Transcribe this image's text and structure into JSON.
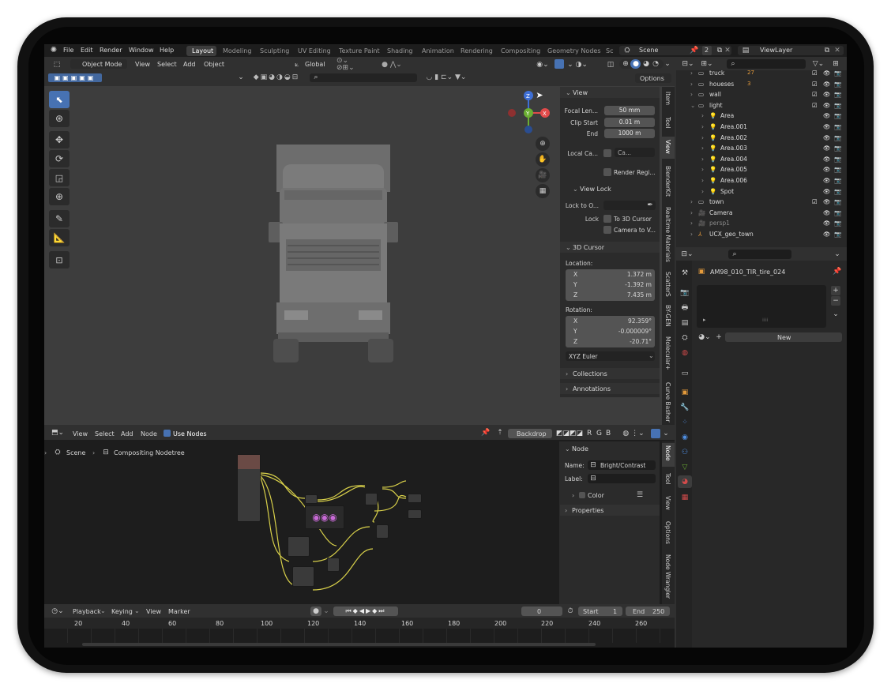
{
  "menubar": {
    "file": "File",
    "edit": "Edit",
    "render": "Render",
    "window": "Window",
    "help": "Help"
  },
  "workspaces": [
    "Layout",
    "Modeling",
    "Sculpting",
    "UV Editing",
    "Texture Paint",
    "Shading",
    "Animation",
    "Rendering",
    "Compositing",
    "Geometry Nodes",
    "Sc"
  ],
  "scene": {
    "label": "Scene",
    "users": "2"
  },
  "viewlayer": "ViewLayer",
  "viewport_header": {
    "mode": "Object Mode",
    "view": "View",
    "select": "Select",
    "add": "Add",
    "object": "Object",
    "transform": "Global",
    "options": "Options"
  },
  "n_panel_view": {
    "title": "View",
    "focal_label": "Focal Len...",
    "focal": "50 mm",
    "clip_start_label": "Clip Start",
    "clip_start": "0.01 m",
    "end_label": "End",
    "clip_end": "1000 m",
    "local_cam_label": "Local Ca...",
    "local_cam_value": "Ca...",
    "render_region": "Render Regi...",
    "view_lock": "View Lock",
    "lock_to_label": "Lock to O...",
    "lock_label": "Lock",
    "to_3d_cursor": "To 3D Cursor",
    "camera_to_view": "Camera to V..."
  },
  "cursor_panel": {
    "title": "3D Cursor",
    "location": "Location:",
    "x_label": "X",
    "y_label": "Y",
    "z_label": "Z",
    "loc_x": "1.372 m",
    "loc_y": "-1.392 m",
    "loc_z": "7.435 m",
    "rotation": "Rotation:",
    "rot_x": "92.359°",
    "rot_y": "-0.000009°",
    "rot_z": "-20.71°",
    "euler": "XYZ Euler",
    "collections": "Collections",
    "annotations": "Annotations"
  },
  "side_tabs": [
    "Item",
    "Tool",
    "View",
    "BlenderKit",
    "Realtime Materials",
    "ScatterS",
    "BY-GEN",
    "Molecular+",
    "Curve Basher"
  ],
  "outliner": {
    "items": [
      {
        "name": "truck",
        "type": "collection",
        "badge": "27"
      },
      {
        "name": "houeses",
        "type": "collection",
        "badge": "3"
      },
      {
        "name": "wall",
        "type": "collection"
      },
      {
        "name": "light",
        "type": "collection"
      },
      {
        "name": "Area",
        "type": "light"
      },
      {
        "name": "Area.001",
        "type": "light"
      },
      {
        "name": "Area.002",
        "type": "light"
      },
      {
        "name": "Area.003",
        "type": "light"
      },
      {
        "name": "Area.004",
        "type": "light"
      },
      {
        "name": "Area.005",
        "type": "light"
      },
      {
        "name": "Area.006",
        "type": "light"
      },
      {
        "name": "Spot",
        "type": "light"
      },
      {
        "name": "town",
        "type": "collection"
      },
      {
        "name": "Camera",
        "type": "camera"
      },
      {
        "name": "persp1",
        "type": "camera"
      },
      {
        "name": "UCX_geo_town",
        "type": "empty"
      }
    ]
  },
  "properties": {
    "object_name": "AM98_010_TIR_tire_024",
    "new_label": "New"
  },
  "node_editor": {
    "view": "View",
    "select": "Select",
    "add": "Add",
    "node": "Node",
    "use_nodes": "Use Nodes",
    "backdrop": "Backdrop",
    "channels": [
      "R",
      "G",
      "B"
    ],
    "breadcrumb_scene": "Scene",
    "breadcrumb_tree": "Compositing Nodetree"
  },
  "node_panel": {
    "title": "Node",
    "name_label": "Name:",
    "name_value": "Bright/Contrast",
    "label_label": "Label:",
    "label_value": "",
    "color": "Color",
    "properties": "Properties"
  },
  "node_tabs": [
    "Node",
    "Tool",
    "View",
    "Options",
    "Node Wrangler"
  ],
  "timeline": {
    "playback": "Playback",
    "keying": "Keying",
    "view": "View",
    "marker": "Marker",
    "frame": "0",
    "start_label": "Start",
    "start": "1",
    "end_label": "End",
    "end": "250",
    "ticks": [
      "20",
      "40",
      "60",
      "80",
      "100",
      "120",
      "140",
      "160",
      "180",
      "200",
      "220",
      "240",
      "260"
    ]
  },
  "colors": {
    "accent": "#4772b3",
    "bg": "#303030",
    "viewport": "#3d3d3d",
    "panel": "#2b2b2b",
    "header": "#262626",
    "light_orange": "#e39a3b",
    "select_box": "#4772b3"
  }
}
